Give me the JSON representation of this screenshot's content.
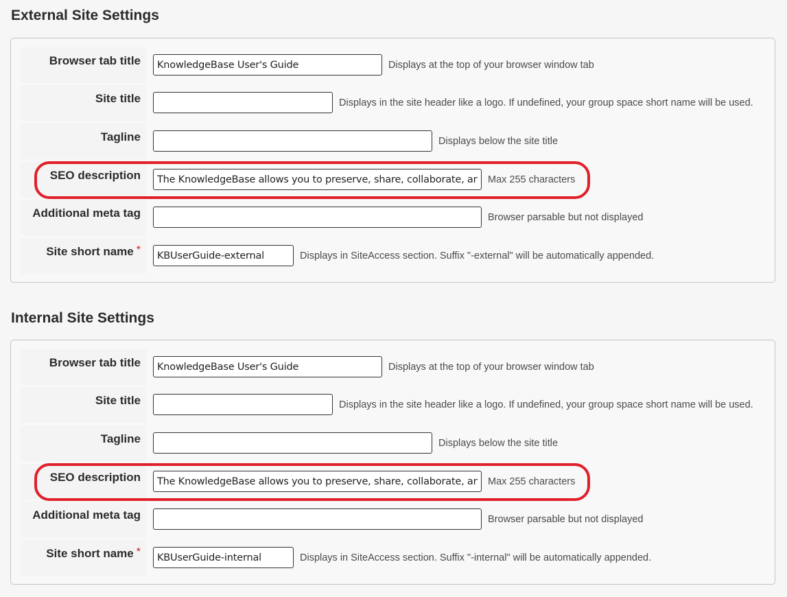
{
  "sections": [
    {
      "title": "External Site Settings",
      "fields": [
        {
          "label": "Browser tab title",
          "value": "KnowledgeBase User's Guide",
          "placeholder": "",
          "hint": "Displays at the top of your browser window tab",
          "required": false
        },
        {
          "label": "Site title",
          "value": "",
          "placeholder": "",
          "hint": "Displays in the site header like a logo. If undefined, your group space short name will be used.",
          "required": false
        },
        {
          "label": "Tagline",
          "value": "",
          "placeholder": "",
          "hint": "Displays below the site title",
          "required": false
        },
        {
          "label": "SEO description",
          "value": "The KnowledgeBase allows you to preserve, share, collaborate, and",
          "placeholder": "",
          "hint": "Max 255 characters",
          "required": false,
          "highlighted": true
        },
        {
          "label": "Additional meta tag",
          "value": "",
          "placeholder": "",
          "hint": "Browser parsable but not displayed",
          "required": false
        },
        {
          "label": "Site short name",
          "value": "KBUserGuide-external",
          "placeholder": "",
          "hint": "Displays in SiteAccess section. Suffix \"-external\" will be automatically appended.",
          "required": true
        }
      ]
    },
    {
      "title": "Internal Site Settings",
      "fields": [
        {
          "label": "Browser tab title",
          "value": "KnowledgeBase User's Guide",
          "placeholder": "",
          "hint": "Displays at the top of your browser window tab",
          "required": false
        },
        {
          "label": "Site title",
          "value": "",
          "placeholder": "",
          "hint": "Displays in the site header like a logo. If undefined, your group space short name will be used.",
          "required": false
        },
        {
          "label": "Tagline",
          "value": "",
          "placeholder": "",
          "hint": "Displays below the site title",
          "required": false
        },
        {
          "label": "SEO description",
          "value": "The KnowledgeBase allows you to preserve, share, collaborate, and",
          "placeholder": "",
          "hint": "Max 255 characters",
          "required": false,
          "highlighted": true
        },
        {
          "label": "Additional meta tag",
          "value": "",
          "placeholder": "",
          "hint": "Browser parsable but not displayed",
          "required": false
        },
        {
          "label": "Site short name",
          "value": "KBUserGuide-internal",
          "placeholder": "",
          "hint": "Displays in SiteAccess section. Suffix \"-internal\" will be automatically appended.",
          "required": true
        }
      ]
    }
  ],
  "required_marker": "*",
  "colors": {
    "highlight": "#e0202a",
    "required": "#d02020",
    "background": "#f6f6f6"
  }
}
